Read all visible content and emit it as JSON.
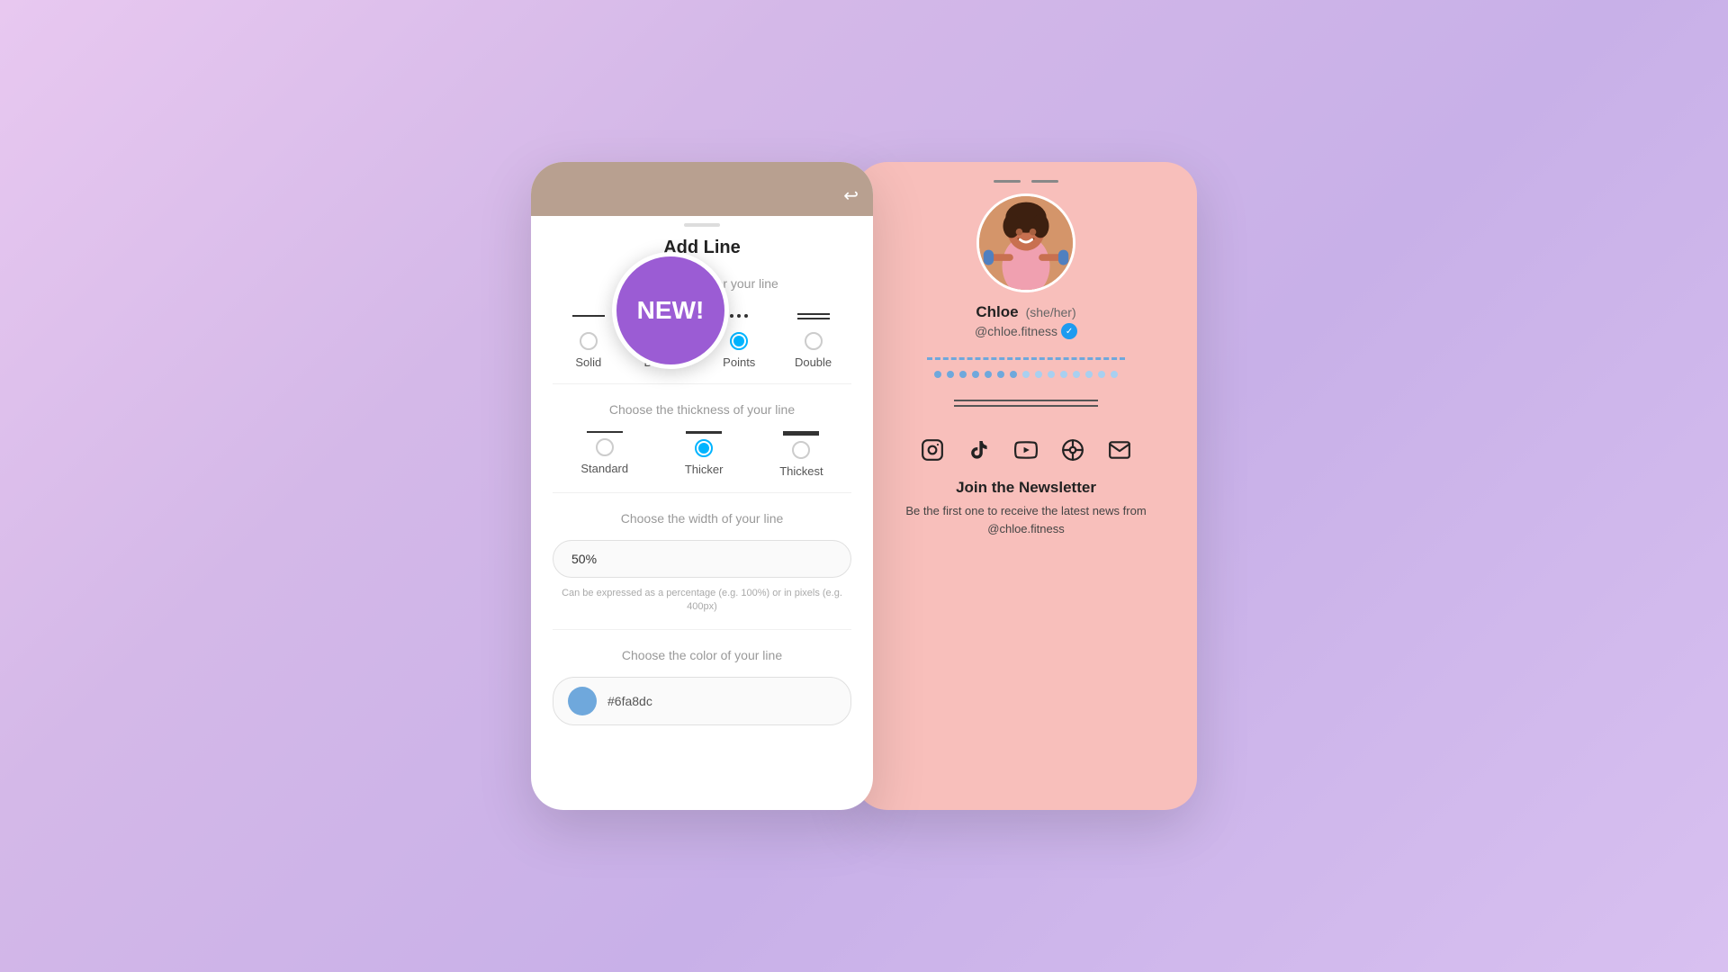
{
  "background": {
    "gradient": "linear-gradient(135deg, #e8c8f0, #d4b8e8, #c8b0e8, #d8c0f0)"
  },
  "new_badge": {
    "label": "NEW!"
  },
  "left_panel": {
    "title": "Add Line",
    "style_section": {
      "label": "Choose a style for your line",
      "options": [
        {
          "id": "solid",
          "label": "Solid",
          "selected": false
        },
        {
          "id": "dashes",
          "label": "Dashes",
          "selected": false
        },
        {
          "id": "points",
          "label": "Points",
          "selected": true
        },
        {
          "id": "double",
          "label": "Double",
          "selected": false
        }
      ]
    },
    "thickness_section": {
      "label": "Choose the thickness of your line",
      "options": [
        {
          "id": "standard",
          "label": "Standard",
          "selected": false
        },
        {
          "id": "thicker",
          "label": "Thicker",
          "selected": true
        },
        {
          "id": "thickest",
          "label": "Thickest",
          "selected": false
        }
      ]
    },
    "width_section": {
      "label": "Choose the width of your line",
      "value": "50%",
      "hint": "Can be expressed as a percentage (e.g. 100%) or in pixels (e.g. 400px)"
    },
    "color_section": {
      "label": "Choose the color of your line",
      "value": "#6fa8dc",
      "swatch_color": "#6fa8dc"
    }
  },
  "right_panel": {
    "profile": {
      "name": "Chloe",
      "pronouns": "(she/her)",
      "handle": "@chloe.fitness",
      "verified": true
    },
    "newsletter": {
      "title": "Join the Newsletter",
      "text": "Be the first one to receive the latest news from @chloe.fitness"
    },
    "social_icons": [
      {
        "name": "instagram-icon",
        "symbol": "⬡"
      },
      {
        "name": "tiktok-icon",
        "symbol": "♪"
      },
      {
        "name": "youtube-icon",
        "symbol": "▶"
      },
      {
        "name": "podcast-icon",
        "symbol": "⊕"
      },
      {
        "name": "email-icon",
        "symbol": "✉"
      }
    ]
  }
}
